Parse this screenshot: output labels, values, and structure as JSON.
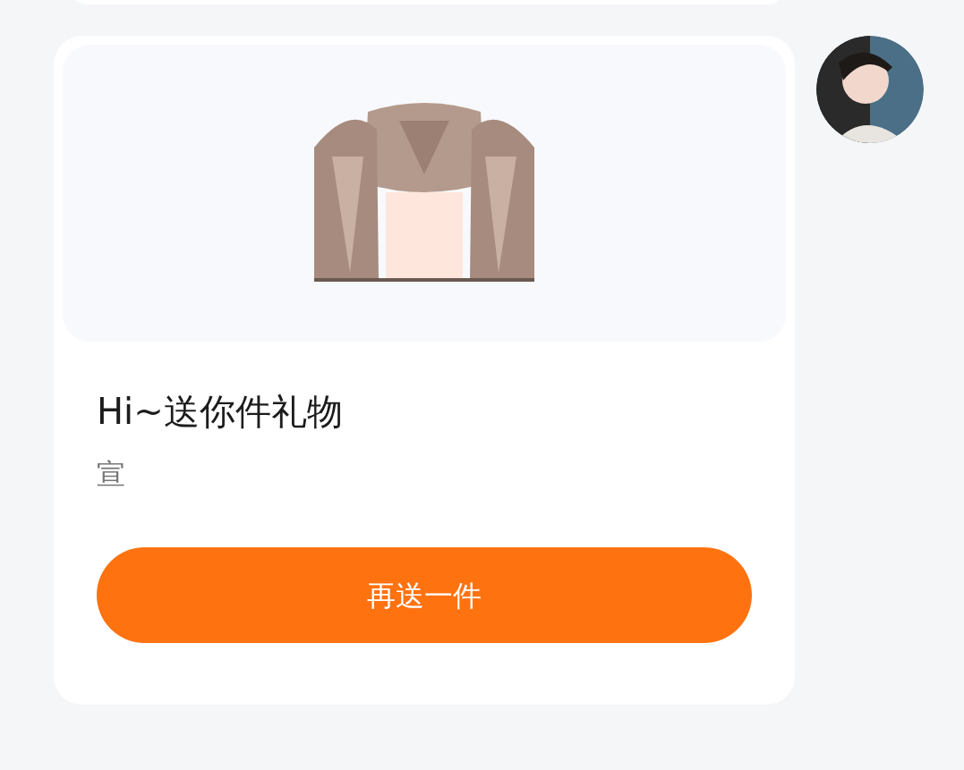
{
  "gift_message": {
    "title": "Hi~送你件礼物",
    "sender": "宣",
    "button": "再送一件"
  }
}
